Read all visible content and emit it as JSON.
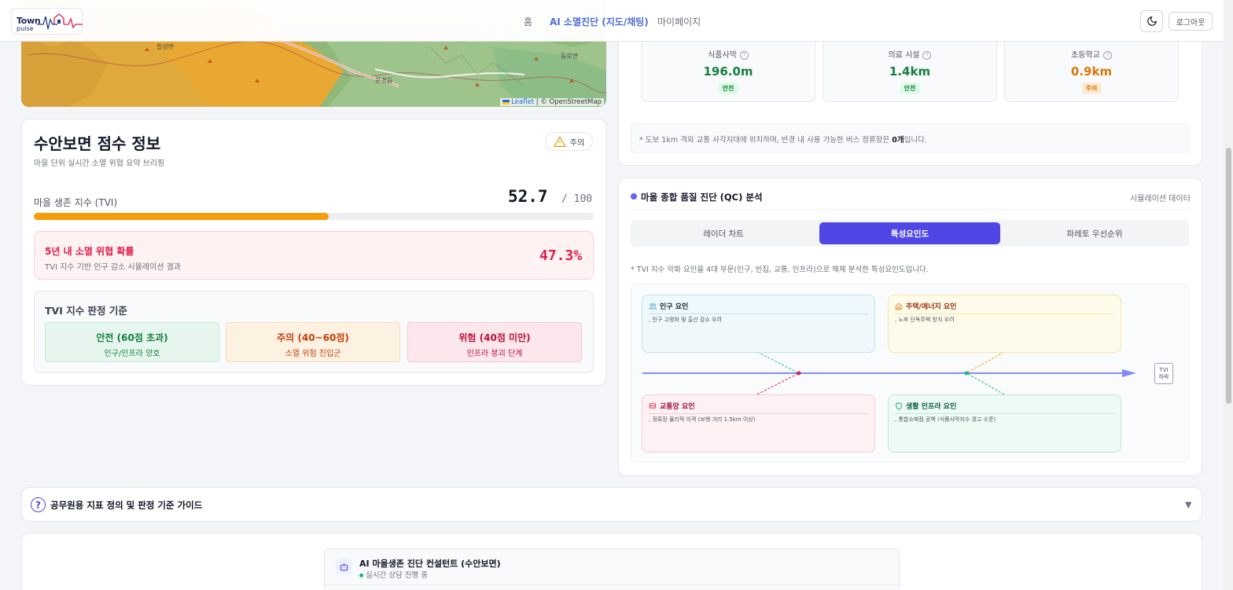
{
  "header": {
    "logo_line1": "Town",
    "logo_line2": "pulse",
    "nav": [
      "홈",
      "AI 소멸진단 (지도/채팅)",
      "마이페이지"
    ],
    "logout": "로그아웃"
  },
  "map": {
    "labels": [
      "칠성면",
      "동로면",
      "문경읍"
    ],
    "attribution_link": "Leaflet",
    "attribution_rest": " | © OpenStreetMap"
  },
  "score": {
    "title": "수안보면 점수 정보",
    "subtitle": "마을 단위 실시간 소멸 위협 요약 브리핑",
    "badge": "주의",
    "tvi_label": "마을 생존 지수 (TVI)",
    "tvi_value": "52.7",
    "tvi_max": "/ 100",
    "tvi_fraction": 0.527,
    "risk_title": "5년 내 소멸 위협 확률",
    "risk_sub": "TVI 지수 기반 인구 감소 시뮬레이션 결과",
    "risk_value": "47.3%",
    "criteria_title": "TVI 지수 판정 기준",
    "criteria": [
      {
        "label": "안전 (60점 초과)",
        "desc": "인구/인프라 양호",
        "bg": "#e6f6ee",
        "border": "#c4ead6",
        "fg": "#15803d"
      },
      {
        "label": "주의 (40~60점)",
        "desc": "소멸 위험 진입군",
        "bg": "#fdf1e2",
        "border": "#f7dcb8",
        "fg": "#c2410c"
      },
      {
        "label": "위험 (40점 미만)",
        "desc": "인프라 붕괴 단계",
        "bg": "#fce7ec",
        "border": "#f6c8d2",
        "fg": "#be123c"
      }
    ]
  },
  "infra": {
    "metrics": [
      {
        "name": "식품사막",
        "value": "196.0m",
        "status": "안전",
        "color": "#15803d",
        "status_bg": "#dcfce7"
      },
      {
        "name": "의료 시설",
        "value": "1.4km",
        "status": "안전",
        "color": "#15803d",
        "status_bg": "#dcfce7"
      },
      {
        "name": "초등학교",
        "value": "0.9km",
        "status": "주의",
        "color": "#d97706",
        "status_bg": "#fdebd3"
      }
    ],
    "bus_note_pre": "* 도보 1km 격외 교통 사각지대에 위치하며, 반경 내 사용 가능한 버스 정류장은 ",
    "bus_note_bold": "0개",
    "bus_note_post": "입니다."
  },
  "qc": {
    "title": "마을 종합 품질 진단 (QC) 분석",
    "sim_label": "시뮬레이션 데이터",
    "tabs": [
      "레이더 차트",
      "특성요인도",
      "파레토 우선순위"
    ],
    "active_tab": 1,
    "desc": "* TVI 지수 악화 요인을 4대 부문(인구, 빈집, 교통, 인프라)으로 해체 분석한 특성요인도입니다.",
    "factors": [
      {
        "title": "인구 요인",
        "detail": ", 인구 고령화 및 출산 감소 우려",
        "bg": "#eff8fb",
        "border": "#bfe3ee",
        "fg": "#1f2937",
        "icon": "users-icon",
        "ic": "#0891b2"
      },
      {
        "title": "주택/에너지 요인",
        "detail": ", 노후 단독주택 방치 우려",
        "bg": "#fefbea",
        "border": "#f5e6a8",
        "fg": "#9a3412",
        "icon": "home-icon",
        "ic": "#d97706"
      },
      {
        "title": "교통망 요인",
        "detail": ", 정류장 물리적 이격 (보행 거리 1.5km 이상)",
        "bg": "#fef1f3",
        "border": "#f7ccd4",
        "fg": "#9f1239",
        "icon": "bus-icon",
        "ic": "#e11d48"
      },
      {
        "title": "생활 인프라 요인",
        "detail": ", 통합소매점 공백 (식품사막지수 경고 수준)",
        "bg": "#eefbf4",
        "border": "#bfe9d3",
        "fg": "#065f46",
        "icon": "shield-icon",
        "ic": "#059669"
      }
    ],
    "head_line1": "TVI",
    "head_line2": "하락"
  },
  "guide": {
    "title": "공무원용 지표 정의 및 판정 기준 가이드"
  },
  "chat": {
    "title": "AI 마을생존 진단 컨설턴트 (수안보면)",
    "status": "실시간 상담 진행 중"
  }
}
